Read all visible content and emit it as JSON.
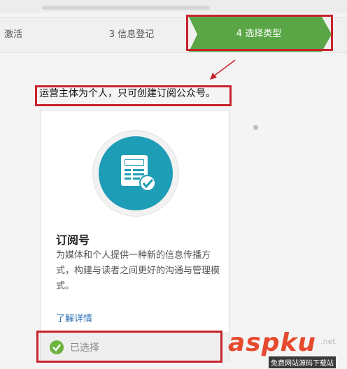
{
  "steps": {
    "step2": "激活",
    "step3": "3 信息登记",
    "step4": "4 选择类型"
  },
  "notice": "运营主体为个人，只可创建订阅公众号。",
  "card": {
    "icon": "subscription-doc-check-icon",
    "title": "订阅号",
    "desc": "为媒体和个人提供一种新的信息传播方式，构建与读者之间更好的沟通与管理模式。",
    "link": "了解详情",
    "selected": "已选择"
  },
  "watermark": {
    "brand": "aspku",
    "sub": "免费网站源码下载站",
    "net": ".net"
  },
  "colors": {
    "active_step": "#5aa646",
    "highlight_box": "#c8232c",
    "icon_bg": "#1e9db6",
    "link": "#2b6fb5",
    "check": "#6cb33f"
  }
}
